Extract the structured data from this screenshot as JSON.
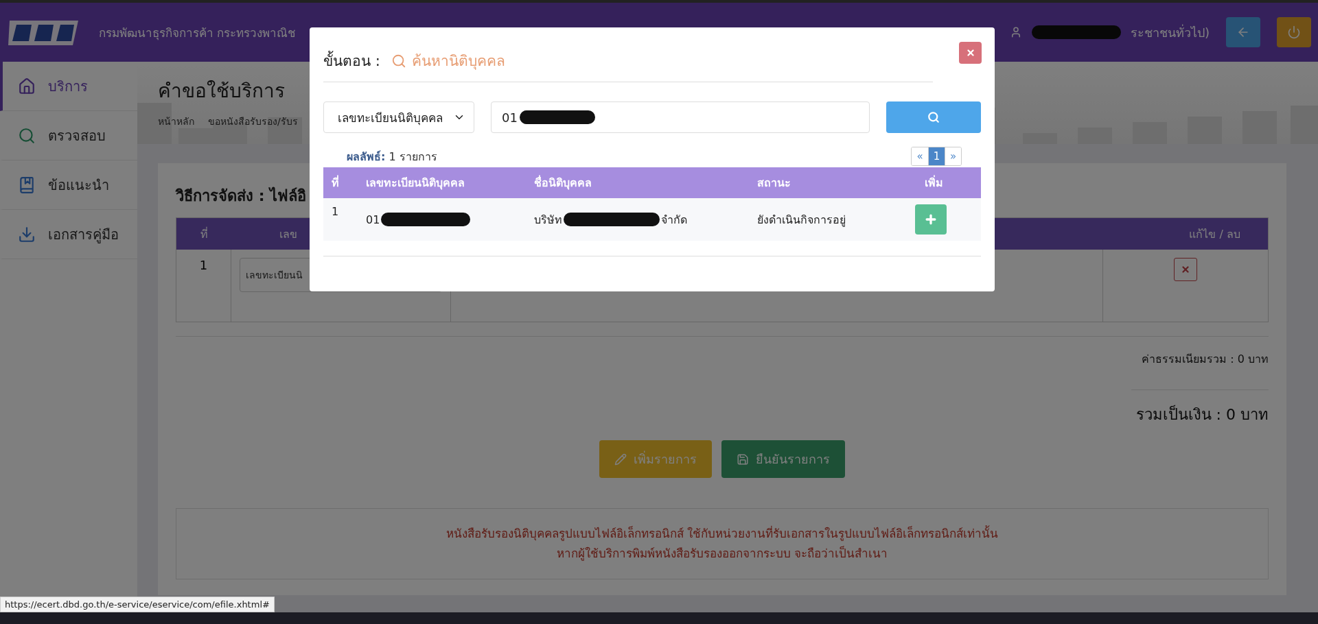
{
  "header": {
    "title": "กรมพัฒนาธุรกิจการค้า กระทรวงพาณิช",
    "user": {
      "redacted": true,
      "text": "ระชาชนทั่วไป)"
    }
  },
  "sidebar": {
    "items": [
      {
        "label": "บริการ",
        "selected": true
      },
      {
        "label": "ตรวจสอบ",
        "selected": false
      },
      {
        "label": "ข้อแนะนำ",
        "selected": false
      },
      {
        "label": "เอกสารคู่มือ",
        "selected": false
      }
    ]
  },
  "page": {
    "title": "คำขอใช้บริการ",
    "breadcrumb": [
      "หน้าหลัก",
      "ขอหนังสือรับรอง/รับร"
    ]
  },
  "card": {
    "title": "วิธีการจัดส่ง : ไฟล์อิ",
    "table": {
      "columns": [
        "ที่",
        "เลข",
        "แก้ไข / ลบ"
      ],
      "rows": [
        {
          "no": "1",
          "select": "เลขทะเบียนนิ"
        }
      ]
    },
    "fee": "ค่าธรรมเนียมรวม : 0 บาท",
    "total": "รวมเป็นเงิน : 0 บาท",
    "buttons": [
      {
        "label": "เพิ่มรายการ",
        "kind": "add"
      },
      {
        "label": "ยืนยันรายการ",
        "kind": "confirm"
      }
    ],
    "notice": [
      "หนังสือรับรองนิติบุคคลรูปแบบไฟล์อิเล็กทรอนิกส์ ใช้กับหน่วยงานที่รับเอกสารในรูปแบบไฟล์อิเล็กทรอนิกส์เท่านั้น",
      "หากผู้ใช้บริการพิมพ์หนังสือรับรองออกจากระบบ จะถือว่าเป็นสำเนา"
    ]
  },
  "status_url": "https://ecert.dbd.go.th/e-service/eservice/com/efile.xhtml#",
  "modal": {
    "step_label": "ขั้นตอน :",
    "step": "ค้นหานิติบุคคล",
    "search_by": "เลขทะเบียนนิติบุคคล",
    "query": {
      "text": "01",
      "redacted": true
    },
    "result_label": "ผลลัพธ์:",
    "result_count": "1 รายการ",
    "pages": [
      {
        "label": "«",
        "selected": false
      },
      {
        "label": "1",
        "selected": true
      },
      {
        "label": "»",
        "selected": false
      }
    ],
    "columns": [
      "ที่",
      "เลขทะเบียนนิติบุคคล",
      "ชื่อนิติบุคคล",
      "สถานะ",
      "เพิ่ม"
    ],
    "rows": [
      {
        "no": "1",
        "id": {
          "text": "01",
          "redacted": true
        },
        "name": {
          "before": "บริษัท",
          "after": "จำกัด",
          "redacted": true
        },
        "status": "ยังดำเนินกิจการอยู่"
      }
    ]
  }
}
